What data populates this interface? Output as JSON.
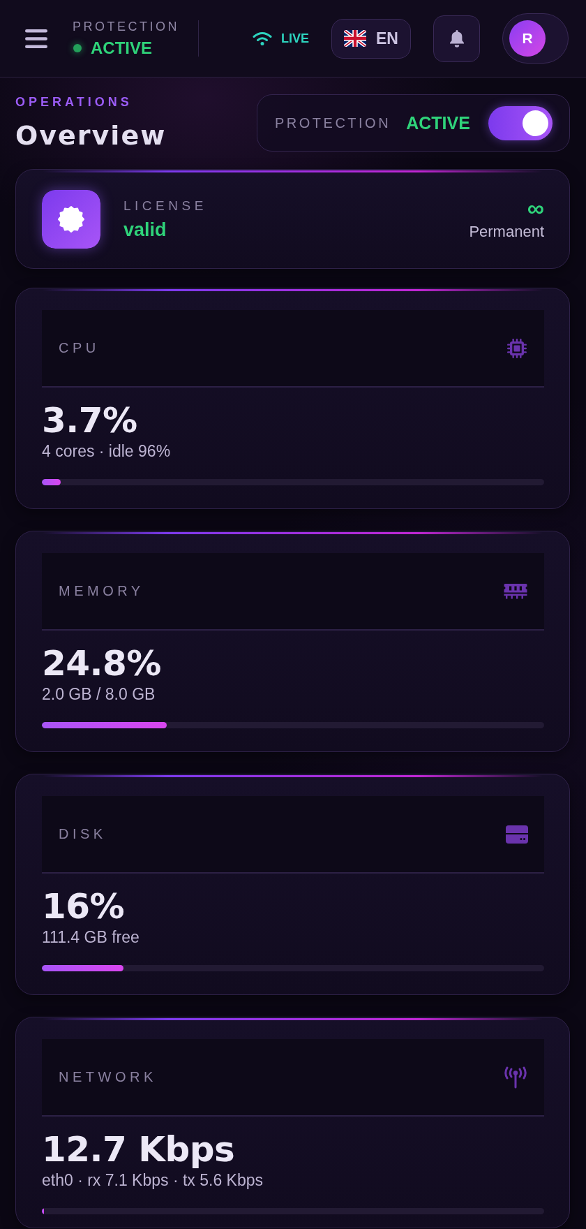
{
  "top_bar": {
    "status": {
      "label": "PROTECTION",
      "value": "ACTIVE",
      "active": true
    },
    "connection": {
      "label": "LIVE"
    },
    "language": {
      "code": "EN"
    },
    "profile": {
      "initial": "R"
    }
  },
  "heading": {
    "eyebrow": "OPERATIONS",
    "title": "Overview"
  },
  "protection": {
    "label": "PROTECTION",
    "status": "ACTIVE",
    "on": true
  },
  "license": {
    "label": "LICENSE",
    "status": "valid",
    "term_symbol": "∞",
    "term": "Permanent"
  },
  "metrics": [
    {
      "kind": "cpu",
      "label": "CPU",
      "value": "3.7%",
      "detail": "4 cores · idle 96%",
      "level": 0.037
    },
    {
      "kind": "memory",
      "label": "MEMORY",
      "value": "24.8%",
      "detail": "2.0 GB / 8.0 GB",
      "level": 0.248
    },
    {
      "kind": "disk",
      "label": "DISK",
      "value": "16%",
      "detail": "111.4 GB free",
      "level": 0.162
    },
    {
      "kind": "network",
      "label": "NETWORK",
      "value": "12.7 Kbps",
      "detail": "eth0 · rx 7.1 Kbps · tx 5.6 Kbps",
      "level": 0.004
    }
  ]
}
